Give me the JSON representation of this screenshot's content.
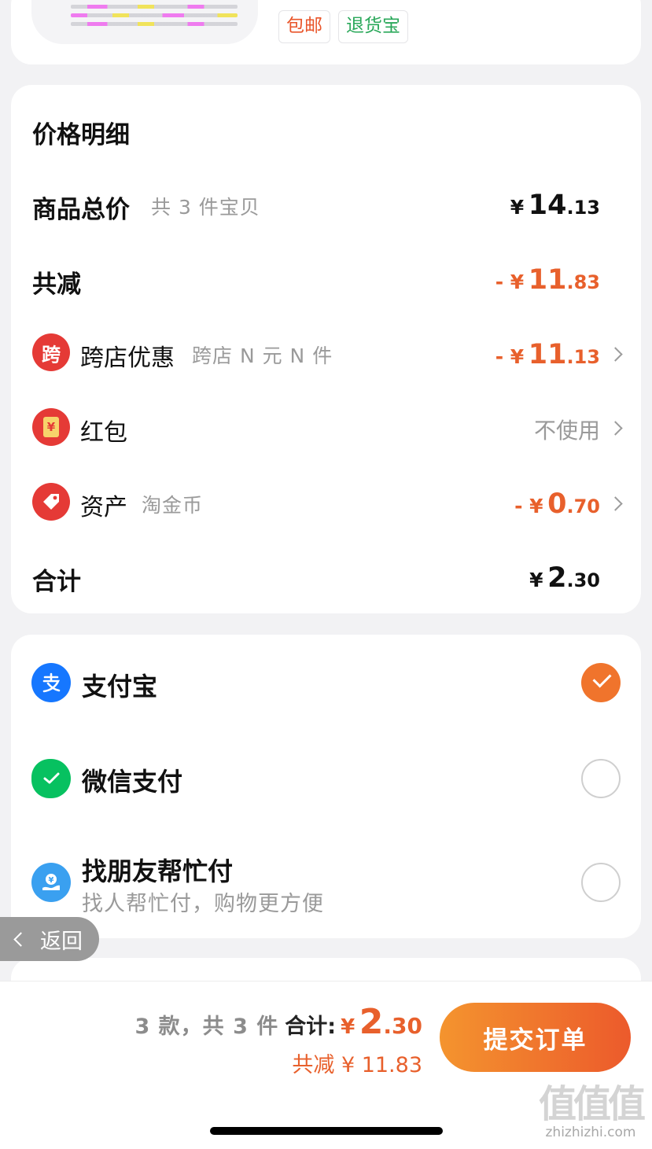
{
  "product": {
    "tags": [
      "包邮",
      "退货宝"
    ]
  },
  "price_detail": {
    "title": "价格明细",
    "goods_total": {
      "label": "商品总价",
      "sub": "共 3 件宝贝",
      "currency": "¥",
      "int": "14",
      "dec": ".13"
    },
    "reduction": {
      "label": "共减",
      "prefix": "- ¥",
      "int": "11",
      "dec": ".83"
    },
    "cross_store": {
      "icon_char": "跨",
      "label": "跨店优惠",
      "sub": "跨店 N 元 N 件",
      "prefix": "- ¥",
      "int": "11",
      "dec": ".13"
    },
    "red_packet": {
      "icon_char": "¥",
      "label": "红包",
      "value": "不使用"
    },
    "assets": {
      "label": "资产",
      "sub": "淘金币",
      "prefix": "- ¥",
      "int": "0",
      "dec": ".70"
    },
    "sum": {
      "label": "合计",
      "currency": "¥",
      "int": "2",
      "dec": ".30"
    }
  },
  "payment": {
    "methods": [
      {
        "label": "支付宝",
        "selected": true,
        "icon": "alipay-icon",
        "color": "#1677ff"
      },
      {
        "label": "微信支付",
        "selected": false,
        "icon": "wechat-pay-icon",
        "color": "#07c160"
      },
      {
        "label": "找朋友帮忙付",
        "sub": "找人帮忙付，购物更方便",
        "selected": false,
        "icon": "friend-pay-icon",
        "color": "#3aa0f0"
      }
    ]
  },
  "back": {
    "label": "返回"
  },
  "bottom": {
    "count_text": "3 款，共 3 件",
    "total_label": "合计:",
    "currency": "¥",
    "total_int": "2",
    "total_dec": ".30",
    "discount_text": "共减 ¥ 11.83",
    "submit_label": "提交订单"
  },
  "watermark": {
    "glyph": "值值值",
    "text": "zhizhizhi.com"
  },
  "colors": {
    "accent": "#e8602c",
    "button_start": "#f4942e",
    "button_end": "#ec5a2c"
  }
}
